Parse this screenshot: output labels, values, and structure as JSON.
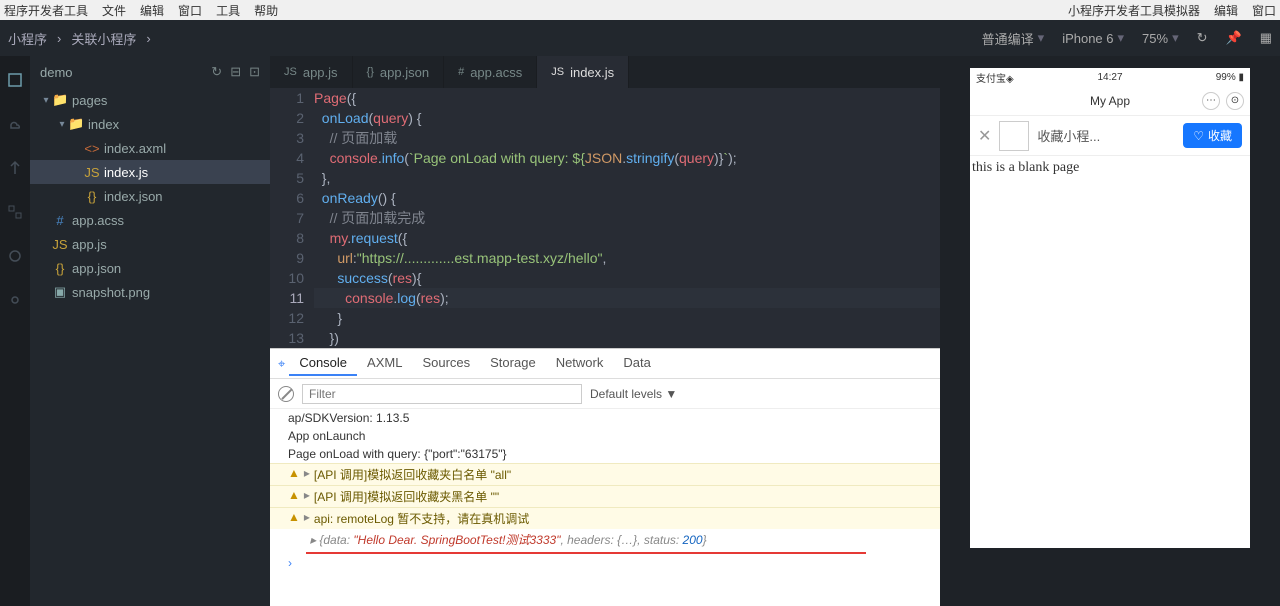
{
  "menubar": {
    "left": [
      "程序开发者工具",
      "文件",
      "编辑",
      "窗口",
      "工具",
      "帮助"
    ],
    "right": [
      "小程序开发者工具模拟器",
      "编辑",
      "窗口"
    ]
  },
  "toolbar": {
    "crumbs": [
      "小程序",
      "关联小程序"
    ],
    "compile": "普通编译",
    "device": "iPhone 6",
    "zoom": "75%"
  },
  "project": {
    "name": "demo",
    "tree": [
      {
        "d": 0,
        "t": "folder",
        "open": true,
        "label": "pages"
      },
      {
        "d": 1,
        "t": "folder",
        "open": true,
        "label": "index"
      },
      {
        "d": 2,
        "t": "axml",
        "label": "index.axml"
      },
      {
        "d": 2,
        "t": "js",
        "label": "index.js",
        "sel": true
      },
      {
        "d": 2,
        "t": "json",
        "label": "index.json"
      },
      {
        "d": 0,
        "t": "css",
        "label": "app.acss"
      },
      {
        "d": 0,
        "t": "js",
        "label": "app.js"
      },
      {
        "d": 0,
        "t": "json",
        "label": "app.json"
      },
      {
        "d": 0,
        "t": "png",
        "label": "snapshot.png"
      }
    ]
  },
  "editorTabs": [
    {
      "icon": "js",
      "label": "app.js"
    },
    {
      "icon": "json",
      "label": "app.json"
    },
    {
      "icon": "css",
      "label": "app.acss"
    },
    {
      "icon": "js",
      "label": "index.js",
      "active": true
    }
  ],
  "code": {
    "lines": [
      {
        "n": 1,
        "seg": [
          {
            "c": "id",
            "t": "Page"
          },
          {
            "c": "pr",
            "t": "({"
          }
        ]
      },
      {
        "n": 2,
        "seg": [
          {
            "c": "pr",
            "t": "  "
          },
          {
            "c": "fn",
            "t": "onLoad"
          },
          {
            "c": "pr",
            "t": "("
          },
          {
            "c": "id",
            "t": "query"
          },
          {
            "c": "pr",
            "t": ") {"
          }
        ]
      },
      {
        "n": 3,
        "seg": [
          {
            "c": "pr",
            "t": "    "
          },
          {
            "c": "cmt",
            "t": "// 页面加载"
          }
        ]
      },
      {
        "n": 4,
        "seg": [
          {
            "c": "pr",
            "t": "    "
          },
          {
            "c": "id",
            "t": "console"
          },
          {
            "c": "pr",
            "t": "."
          },
          {
            "c": "fn",
            "t": "info"
          },
          {
            "c": "pr",
            "t": "("
          },
          {
            "c": "str",
            "t": "`Page onLoad with query: ${"
          },
          {
            "c": "prop",
            "t": "JSON"
          },
          {
            "c": "pr",
            "t": "."
          },
          {
            "c": "fn",
            "t": "stringify"
          },
          {
            "c": "pr",
            "t": "("
          },
          {
            "c": "id",
            "t": "query"
          },
          {
            "c": "pr",
            "t": ")}"
          },
          {
            "c": "str",
            "t": "`"
          },
          {
            "c": "pr",
            "t": ");"
          }
        ]
      },
      {
        "n": 5,
        "seg": [
          {
            "c": "pr",
            "t": "  },"
          }
        ]
      },
      {
        "n": 6,
        "seg": [
          {
            "c": "pr",
            "t": "  "
          },
          {
            "c": "fn",
            "t": "onReady"
          },
          {
            "c": "pr",
            "t": "() {"
          }
        ]
      },
      {
        "n": 7,
        "seg": [
          {
            "c": "pr",
            "t": "    "
          },
          {
            "c": "cmt",
            "t": "// 页面加载完成"
          }
        ]
      },
      {
        "n": 8,
        "seg": [
          {
            "c": "pr",
            "t": "    "
          },
          {
            "c": "id",
            "t": "my"
          },
          {
            "c": "pr",
            "t": "."
          },
          {
            "c": "fn",
            "t": "request"
          },
          {
            "c": "pr",
            "t": "({"
          }
        ]
      },
      {
        "n": 9,
        "seg": [
          {
            "c": "pr",
            "t": "      "
          },
          {
            "c": "prop",
            "t": "url"
          },
          {
            "c": "pr",
            "t": ":"
          },
          {
            "c": "str",
            "t": "\"https://.............est.mapp-test.xyz/hello\""
          },
          {
            "c": "pr",
            "t": ","
          }
        ]
      },
      {
        "n": 10,
        "seg": [
          {
            "c": "pr",
            "t": "      "
          },
          {
            "c": "fn",
            "t": "success"
          },
          {
            "c": "pr",
            "t": "("
          },
          {
            "c": "id",
            "t": "res"
          },
          {
            "c": "pr",
            "t": "){"
          }
        ]
      },
      {
        "n": 11,
        "cur": true,
        "seg": [
          {
            "c": "pr",
            "t": "        "
          },
          {
            "c": "id",
            "t": "console"
          },
          {
            "c": "pr",
            "t": "."
          },
          {
            "c": "fn",
            "t": "log"
          },
          {
            "c": "pr",
            "t": "("
          },
          {
            "c": "id",
            "t": "res"
          },
          {
            "c": "pr",
            "t": ");"
          }
        ]
      },
      {
        "n": 12,
        "seg": [
          {
            "c": "pr",
            "t": "      }"
          }
        ]
      },
      {
        "n": 13,
        "seg": [
          {
            "c": "pr",
            "t": "    })"
          }
        ]
      }
    ]
  },
  "devtools": {
    "tabs": [
      "Console",
      "AXML",
      "Sources",
      "Storage",
      "Network",
      "Data"
    ],
    "activeTab": 0,
    "filterPlaceholder": "Filter",
    "levels": "Default levels ▼",
    "logs": [
      {
        "type": "log",
        "text": "ap/SDKVersion: 1.13.5"
      },
      {
        "type": "log",
        "text": "App onLaunch"
      },
      {
        "type": "log",
        "text": "Page onLoad with query: {\"port\":\"63175\"}"
      },
      {
        "type": "warn",
        "text": "[API 调用]模拟返回收藏夹白名单 \"all\""
      },
      {
        "type": "warn",
        "text": "[API 调用]模拟返回收藏夹黑名单 \"\""
      },
      {
        "type": "warn",
        "text": "api: remoteLog 暂不支持，请在真机调试"
      },
      {
        "type": "res",
        "prefix": "{data: ",
        "str": "\"Hello Dear. SpringBootTest!测试3333\"",
        "mid": ", headers: {…}, status: ",
        "num": "200",
        "suffix": "}"
      }
    ]
  },
  "sim": {
    "carrier": "支付宝◈",
    "time": "14:27",
    "battery": "99%",
    "title": "My App",
    "barText": "收藏小程...",
    "favLabel": "收藏",
    "body": "this is a blank page"
  }
}
